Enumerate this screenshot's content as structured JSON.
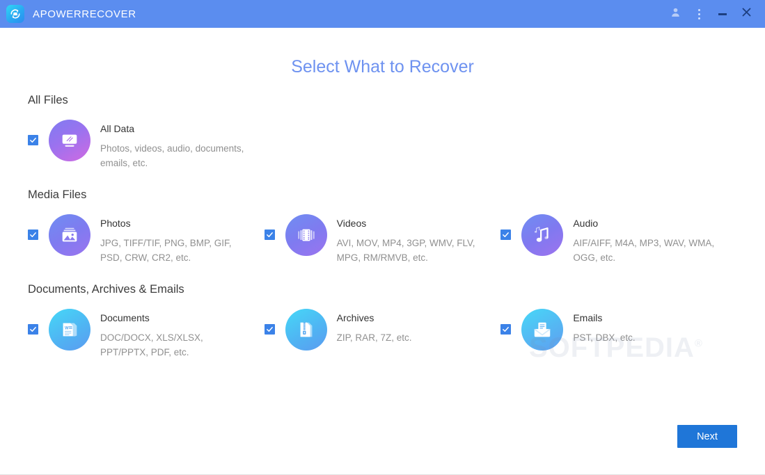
{
  "titlebar": {
    "app_name": "APOWERRECOVER",
    "logo_icon": "recover-logo-icon",
    "background_color": "#5b8def",
    "buttons": [
      {
        "name": "account-icon",
        "label": ""
      },
      {
        "name": "more-menu-icon",
        "label": ""
      },
      {
        "name": "minimize-icon",
        "label": ""
      },
      {
        "name": "close-icon",
        "label": ""
      }
    ]
  },
  "page": {
    "heading": "Select What to Recover",
    "heading_color": "#6e92f0"
  },
  "sections": [
    {
      "title": "All Files",
      "items": [
        {
          "title": "All Data",
          "desc": "Photos, videos, audio, documents, emails, etc.",
          "icon": "all-data-icon",
          "icon_class": "ic-alldata",
          "checked": true
        }
      ]
    },
    {
      "title": "Media Files",
      "items": [
        {
          "title": "Photos",
          "desc": "JPG, TIFF/TIF, PNG, BMP, GIF, PSD, CRW, CR2, etc.",
          "icon": "photos-icon",
          "icon_class": "ic-photos",
          "checked": true
        },
        {
          "title": "Videos",
          "desc": "AVI, MOV, MP4, 3GP, WMV, FLV, MPG, RM/RMVB, etc.",
          "icon": "videos-icon",
          "icon_class": "ic-videos",
          "checked": true
        },
        {
          "title": "Audio",
          "desc": "AIF/AIFF, M4A, MP3, WAV, WMA, OGG, etc.",
          "icon": "audio-icon",
          "icon_class": "ic-audio",
          "checked": true
        }
      ]
    },
    {
      "title": "Documents, Archives & Emails",
      "items": [
        {
          "title": "Documents",
          "desc": "DOC/DOCX, XLS/XLSX, PPT/PPTX, PDF, etc.",
          "icon": "documents-icon",
          "icon_class": "ic-docs",
          "checked": true
        },
        {
          "title": "Archives",
          "desc": "ZIP, RAR, 7Z, etc.",
          "icon": "archives-icon",
          "icon_class": "ic-archives",
          "checked": true
        },
        {
          "title": "Emails",
          "desc": "PST, DBX, etc.",
          "icon": "emails-icon",
          "icon_class": "ic-emails",
          "checked": true
        }
      ]
    }
  ],
  "footer": {
    "next_label": "Next",
    "next_color": "#1f76d8"
  },
  "watermark": {
    "text": "SOFTPEDIA",
    "mark": "®"
  }
}
